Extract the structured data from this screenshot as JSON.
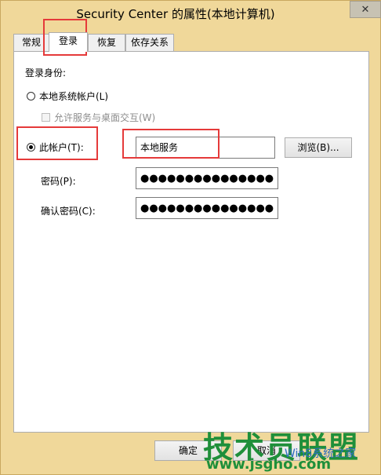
{
  "window": {
    "title": "Security Center 的属性(本地计算机)",
    "close_symbol": "✕"
  },
  "tabs": [
    {
      "label": "常规",
      "active": false
    },
    {
      "label": "登录",
      "active": true
    },
    {
      "label": "恢复",
      "active": false
    },
    {
      "label": "依存关系",
      "active": false
    }
  ],
  "logon": {
    "section_label": "登录身份:",
    "local_system_label": "本地系统帐户(L)",
    "allow_interact_label": "允许服务与桌面交互(W)",
    "this_account_label": "此帐户(T):",
    "account_value": "本地服务",
    "browse_label": "浏览(B)...",
    "password_label": "密码(P):",
    "password_value": "●●●●●●●●●●●●●●●",
    "confirm_label": "确认密码(C):",
    "confirm_value": "●●●●●●●●●●●●●●●"
  },
  "buttons": {
    "ok_label": "确定",
    "cancel_label": "取消"
  },
  "watermark": {
    "brand": "技术员联盟",
    "url": "www.jsgho.com",
    "os_text": "Win8系统之家"
  },
  "colors": {
    "window_bg": "#f0d89a",
    "highlight": "#e53a3a",
    "watermark_green": "#1f8f3a"
  }
}
